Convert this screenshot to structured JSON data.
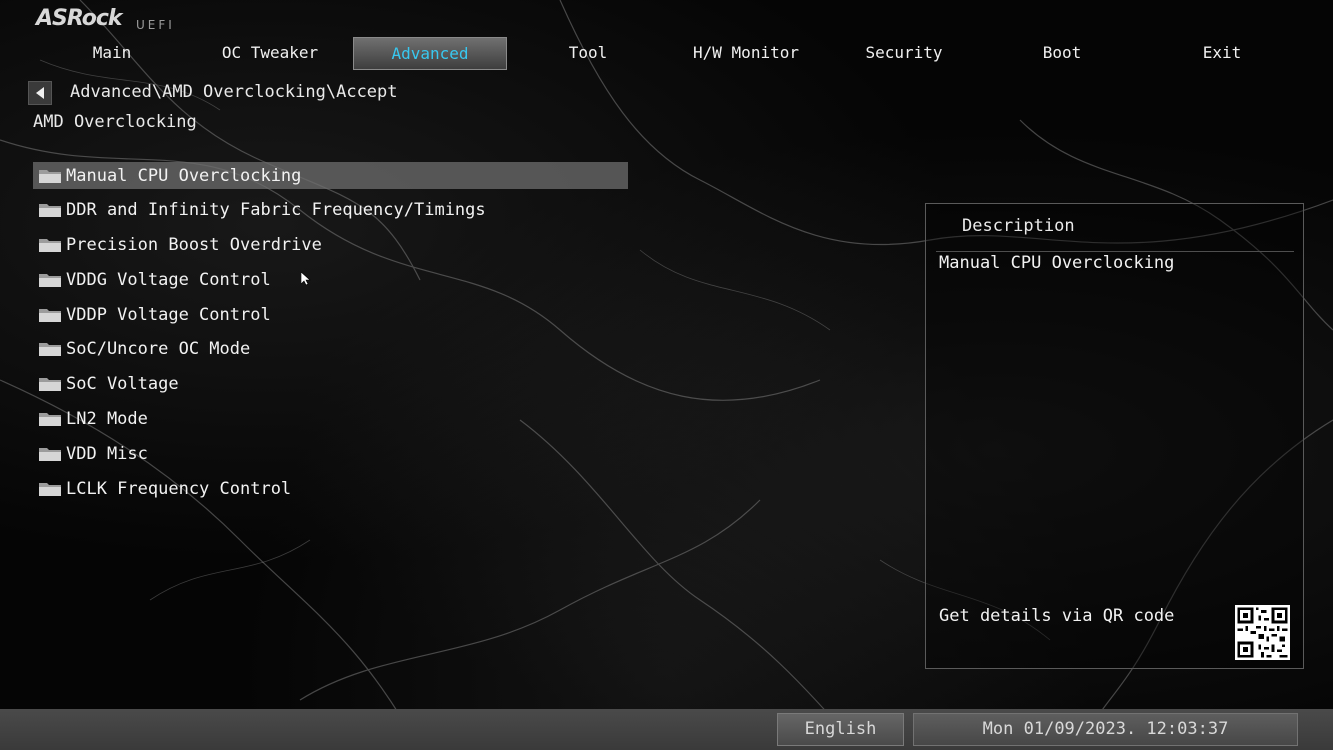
{
  "brand": {
    "logo_text": "ASRock",
    "logo_sub": "UEFI"
  },
  "nav": {
    "tabs": [
      {
        "label": "Main",
        "active": false
      },
      {
        "label": "OC Tweaker",
        "active": false
      },
      {
        "label": "Advanced",
        "active": true
      },
      {
        "label": "Tool",
        "active": false
      },
      {
        "label": "H/W Monitor",
        "active": false
      },
      {
        "label": "Security",
        "active": false
      },
      {
        "label": "Boot",
        "active": false
      },
      {
        "label": "Exit",
        "active": false
      }
    ]
  },
  "breadcrumb": "Advanced\\AMD Overclocking\\Accept",
  "page_title": "AMD Overclocking",
  "menu": {
    "items": [
      {
        "label": "Manual CPU Overclocking",
        "selected": true
      },
      {
        "label": "DDR and Infinity Fabric Frequency/Timings",
        "selected": false
      },
      {
        "label": "Precision Boost Overdrive",
        "selected": false
      },
      {
        "label": "VDDG Voltage Control",
        "selected": false
      },
      {
        "label": "VDDP Voltage Control",
        "selected": false
      },
      {
        "label": "SoC/Uncore OC Mode",
        "selected": false
      },
      {
        "label": "SoC Voltage",
        "selected": false
      },
      {
        "label": "LN2 Mode",
        "selected": false
      },
      {
        "label": "VDD Misc",
        "selected": false
      },
      {
        "label": "LCLK Frequency Control",
        "selected": false
      }
    ]
  },
  "description": {
    "header": "Description",
    "text": "Manual CPU Overclocking",
    "qr_label": "Get details via QR code"
  },
  "footer": {
    "language": "English",
    "datetime": "Mon 01/09/2023. 12:03:37"
  },
  "colors": {
    "active_tab_text": "#38c8f0",
    "selected_row": "#6e6e6e",
    "background": "#050505"
  },
  "icons": {
    "menu_item": "folder-icon",
    "back": "back-arrow-icon",
    "pointer": "mouse-pointer-icon"
  }
}
